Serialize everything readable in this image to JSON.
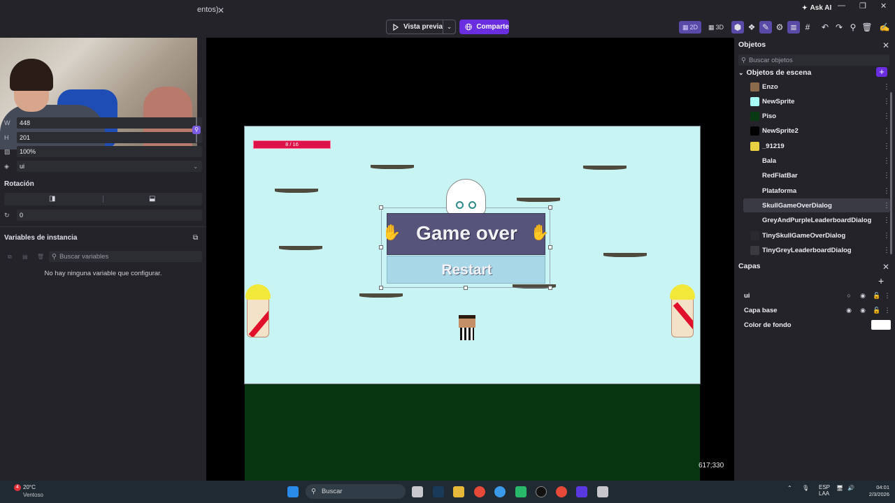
{
  "tab": {
    "fragment": "entos)",
    "close": "✕"
  },
  "toolbar": {
    "preview_label": "Vista previa",
    "share_label": "Comparte",
    "ask_ai": "Ask AI",
    "view_2d": "2D",
    "view_3d": "3D"
  },
  "window": {
    "minimize": "—",
    "maximize": "❐",
    "close": "✕"
  },
  "properties": {
    "width_label": "W",
    "width_value": "448",
    "height_label": "H",
    "height_value": "201",
    "opacity_value": "100%",
    "layer_value": "ui",
    "rotation_title": "Rotación",
    "rotation_value": "0"
  },
  "instance_vars": {
    "title": "Variables de instancia",
    "search_placeholder": "Buscar variables",
    "empty_text": "No hay ninguna variable que configurar."
  },
  "game": {
    "health_text": "8 / 16",
    "dialog_title": "Game over",
    "dialog_button": "Restart"
  },
  "canvas": {
    "coords": "617;330"
  },
  "objects_panel": {
    "title": "Objetos",
    "search_placeholder": "Buscar objetos",
    "folder_label": "Objetos de escena",
    "items": [
      {
        "name": "Enzo",
        "thumb": "#8a6a4a"
      },
      {
        "name": "NewSprite",
        "thumb": "#a8fff8"
      },
      {
        "name": "Piso",
        "thumb": "#0a3a14"
      },
      {
        "name": "NewSprite2",
        "thumb": "#000000"
      },
      {
        "name": "_91219",
        "thumb": "#e8d040"
      },
      {
        "name": "Bala",
        "thumb": "#232329"
      },
      {
        "name": "RedFlatBar",
        "thumb": "#232329"
      },
      {
        "name": "Plataforma",
        "thumb": "#232329"
      },
      {
        "name": "SkullGameOverDialog",
        "thumb": "#3a3a44"
      },
      {
        "name": "GreyAndPurpleLeaderboardDialog",
        "thumb": "#232329"
      },
      {
        "name": "TinySkullGameOverDialog",
        "thumb": "#2a2a30"
      },
      {
        "name": "TinyGreyLeaderboardDialog",
        "thumb": "#3a3a40"
      }
    ],
    "selected_index": 8
  },
  "layers_panel": {
    "title": "Capas",
    "layers": [
      {
        "name": "ui"
      },
      {
        "name": "Capa base"
      }
    ],
    "bg_color_label": "Color de fondo",
    "bg_color": "#ffffff"
  },
  "taskbar": {
    "temperature": "20°C",
    "condition": "Ventoso",
    "notification_count": "4",
    "search_label": "Buscar",
    "lang_top": "ESP",
    "lang_bottom": "LAA",
    "time": "04:01",
    "date": "2/3/2026"
  },
  "colors": {
    "accent": "#6a2ee0",
    "scene_bg": "#c8f5f3",
    "ground": "#063510",
    "health_bar": "#dc1248"
  }
}
